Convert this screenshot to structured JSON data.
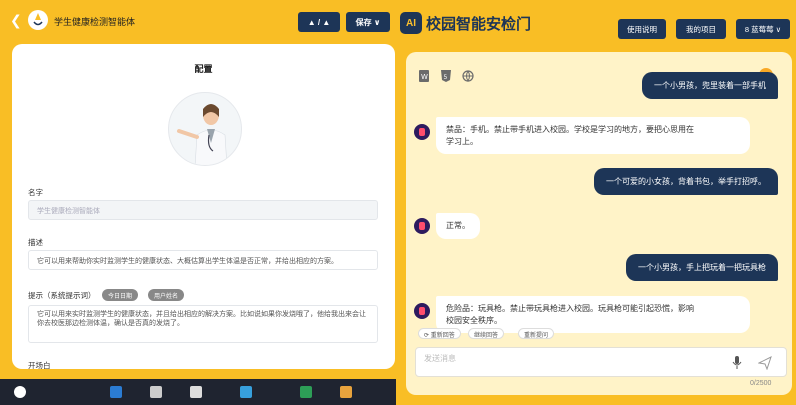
{
  "left": {
    "header": {
      "title": "学生健康检测智能体",
      "share_label": "▲ / ▲",
      "save_label": "保存 ∨"
    },
    "config": {
      "title": "配置",
      "name_label": "名字",
      "name_placeholder": "学生健康检测智能体",
      "desc_label": "描述",
      "desc_value": "它可以用来帮助你实时监测学生的健康状态、大概估算出学生体温是否正常，并给出相应的方案。",
      "prompt_label": "提示（系统提示词）",
      "chip_date": "今日日期",
      "chip_user": "用户姓名",
      "prompt_value": "它可以用来实时监测学生的健康状态，并且给出相应的解决方案。比如说如果你发烧哦了，他给我出来会让你去校医那边检测体温，确认是否真的发烧了。",
      "opening_label": "开场白"
    }
  },
  "right": {
    "brand": "校园智能安检门",
    "logo_text": "AI",
    "nav": {
      "guide": "使用说明",
      "projects": "我的项目",
      "user": "8 蓝莓莓 ∨"
    },
    "messages": [
      {
        "role": "user",
        "text": "一个小男孩，兜里装着一部手机"
      },
      {
        "role": "bot",
        "line1": "禁品：手机。禁止带手机进入校园。学校是学习的地方，要把心思用在",
        "line2": "学习上。"
      },
      {
        "role": "user",
        "text": "一个可爱的小女孩，背着书包，举手打招呼。"
      },
      {
        "role": "bot",
        "line1": "正常。"
      },
      {
        "role": "user",
        "text": "一个小男孩，手上把玩着一把玩具枪"
      },
      {
        "role": "bot",
        "line1": "危险品：玩具枪。禁止带玩具枪进入校园。玩具枪可能引起恐慌，影响",
        "line2": "校园安全秩序。"
      }
    ],
    "actions": {
      "regen": "⟳ 重新回答",
      "continue": "继续回答",
      "retry": "重新提问"
    },
    "input_placeholder": "发送消息",
    "counter": "0/2500"
  }
}
